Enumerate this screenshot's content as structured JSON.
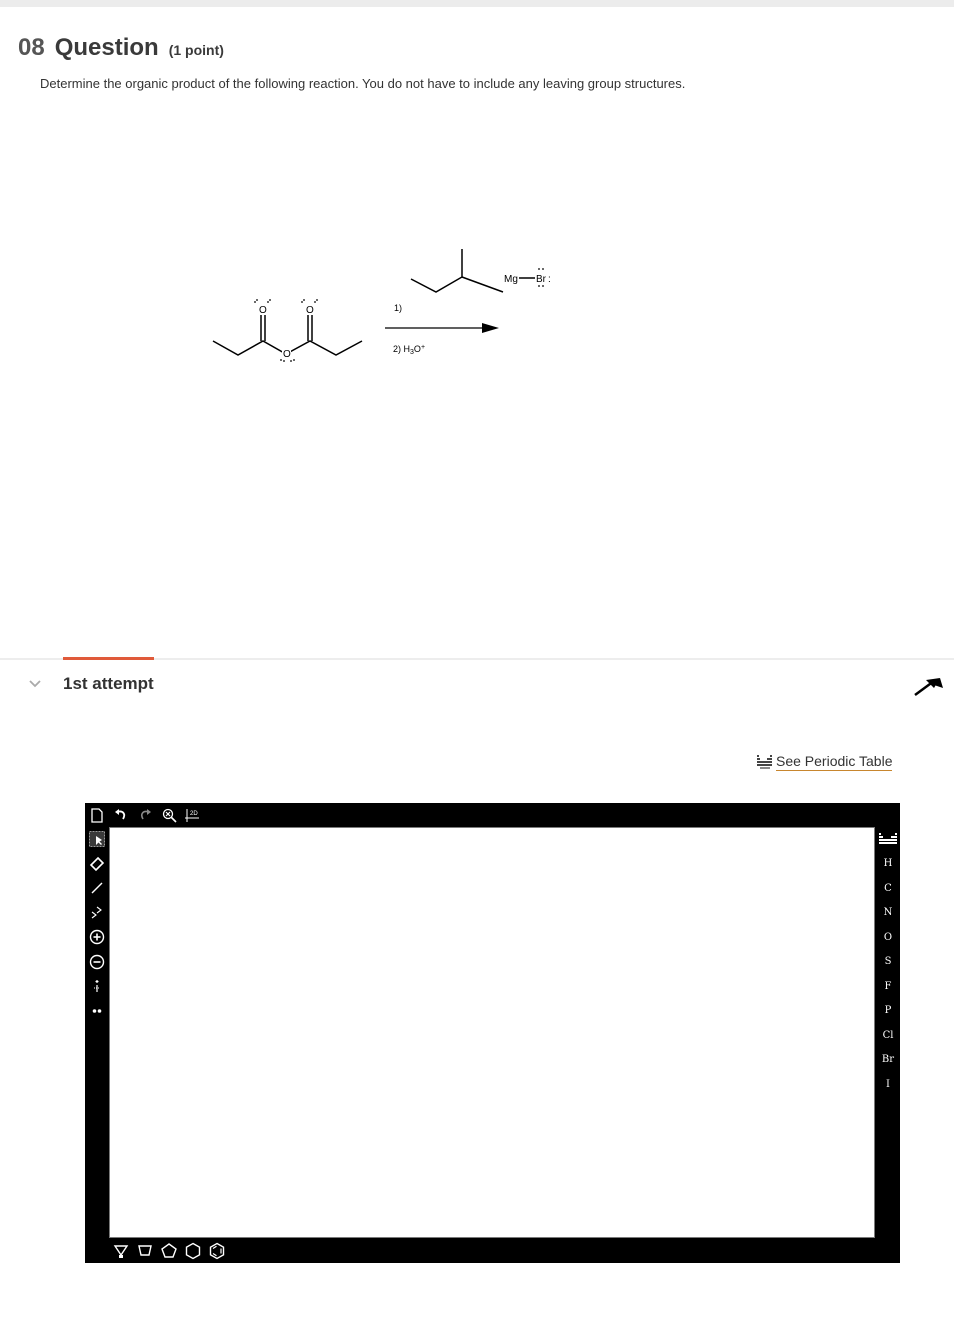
{
  "question": {
    "number": "08",
    "title": "Question",
    "points": "(1 point)",
    "prompt": "Determine the organic product of the following reaction. You do not have to include any leaving group structures."
  },
  "reaction": {
    "reagent": {
      "mg_label": "Mg",
      "br_label": "Br",
      "br_lone_pair_right": ":"
    },
    "ester": {
      "carbonyl_oxygen_label": "O",
      "ether_oxygen_label": "O"
    },
    "step1_label": "1)",
    "step2_prefix": "2) H",
    "step2_sub": "3",
    "step2_suffix": "O",
    "step2_sup": "+"
  },
  "attempt": {
    "label": "1st attempt"
  },
  "periodic_table": {
    "link_text": "See Periodic Table"
  },
  "editor": {
    "top_toolbar_icons": [
      "new-document-icon",
      "undo-icon",
      "redo-icon",
      "zoom-icon",
      "2d-clean-icon"
    ],
    "clean_label": "2D",
    "left_toolbar_icons": [
      "select-icon",
      "eraser-icon",
      "single-bond-icon",
      "chain-icon",
      "positive-charge-icon",
      "negative-charge-icon",
      "electron-arrow-icon",
      "lone-pair-icon"
    ],
    "bottom_toolbar_icons": [
      "cyclopropane-icon",
      "cyclobutane-icon",
      "cyclopentane-icon",
      "cyclohexane-icon",
      "benzene-icon"
    ],
    "elements": [
      "H",
      "C",
      "N",
      "O",
      "S",
      "F",
      "P",
      "Cl",
      "Br",
      "I"
    ]
  }
}
